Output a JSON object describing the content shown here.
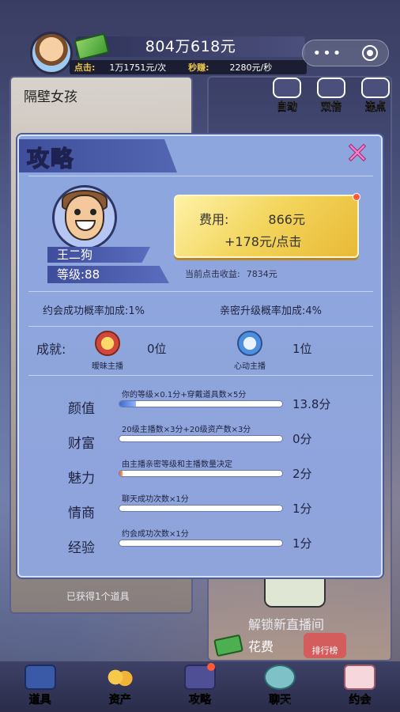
{
  "header": {
    "total_money": "804万618元",
    "click_label": "点击:",
    "click_value": "1万1751元/次",
    "second_label": "秒赚:",
    "second_value": "2280元/秒"
  },
  "side_buttons": [
    {
      "label": "自动"
    },
    {
      "label": "双倍"
    },
    {
      "label": "连点"
    }
  ],
  "background": {
    "card_title": "隔壁女孩",
    "bottom_text": "已获得1个道具",
    "unlock_text": "解锁新直播间",
    "spend_text": "花费",
    "rank_text": "排行榜"
  },
  "modal": {
    "title": "攻略",
    "close": "✕",
    "profile": {
      "name": "王二狗",
      "level": "等级:88"
    },
    "cost": {
      "label": "费用:",
      "amount": "866元",
      "gain": "+178元/点击"
    },
    "current_income": {
      "label": "当前点击收益:",
      "value": "7834元"
    },
    "bonuses": {
      "date_success": "约会成功概率加成:1%",
      "intimacy_upgrade": "亲密升级概率加成:4%"
    },
    "achievements": {
      "label": "成就:",
      "items": [
        {
          "name": "暧昧主播",
          "count": "0位",
          "icon": "gold-star-badge"
        },
        {
          "name": "心动主播",
          "count": "1位",
          "icon": "blue-star-badge"
        }
      ]
    },
    "stats": [
      {
        "name": "颜值",
        "desc": "你的等级×0.1分+穿戴道具数×5分",
        "score": "13.8分",
        "progress": 0.1
      },
      {
        "name": "财富",
        "desc": "20级主播数×3分+20级资产数×3分",
        "score": "0分",
        "progress": 0.0
      },
      {
        "name": "魅力",
        "desc": "由主播亲密等级和主播数量决定",
        "score": "2分",
        "progress": 0.02
      },
      {
        "name": "情商",
        "desc": "聊天成功次数×1分",
        "score": "1分",
        "progress": 0.0
      },
      {
        "name": "经验",
        "desc": "约会成功次数×1分",
        "score": "1分",
        "progress": 0.0
      }
    ]
  },
  "bottom_nav": [
    {
      "label": "道具",
      "icon": "toolbox-icon"
    },
    {
      "label": "资产",
      "icon": "coins-icon"
    },
    {
      "label": "攻略",
      "icon": "book-icon"
    },
    {
      "label": "聊天",
      "icon": "chat-icon"
    },
    {
      "label": "约会",
      "icon": "letter-icon"
    }
  ]
}
